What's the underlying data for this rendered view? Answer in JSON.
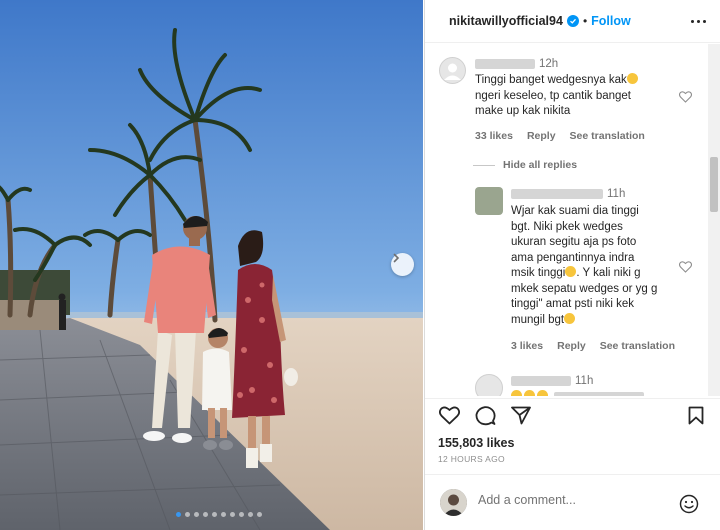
{
  "post": {
    "username": "nikitawillyofficial94",
    "separator": "•",
    "follow_label": "Follow",
    "likes": "155,803 likes",
    "posted_ago": "12 HOURS AGO",
    "comment_placeholder": "Add a comment...",
    "carousel": {
      "total_slides": 10,
      "active_index": 0
    }
  },
  "comments": [
    {
      "time": "12h",
      "lines": [
        "Tinggi banget wedgesnya kak",
        "ngeri keseleo, tp cantik banget",
        "make up kak nikita"
      ],
      "likes": "33 likes",
      "reply": "Reply",
      "translate": "See translation"
    }
  ],
  "hide_replies": "Hide all replies",
  "replies": [
    {
      "time": "11h",
      "lines": [
        "Wjar kak suami dia tinggi",
        "bgt. Niki pkek wedges",
        "ukuran segitu aja ps foto",
        "ama pengantinnya indra",
        "msik tinggi",
        ". Y kali niki g",
        "mkek sepatu wedges or yg g",
        "tinggi\" amat psti niki kek",
        "mungil bgt"
      ],
      "likes": "3 likes",
      "reply": "Reply",
      "translate": "See translation"
    },
    {
      "time": "11h"
    }
  ],
  "colors": {
    "accent": "#0095f6",
    "text": "#262626",
    "muted": "#737373"
  }
}
